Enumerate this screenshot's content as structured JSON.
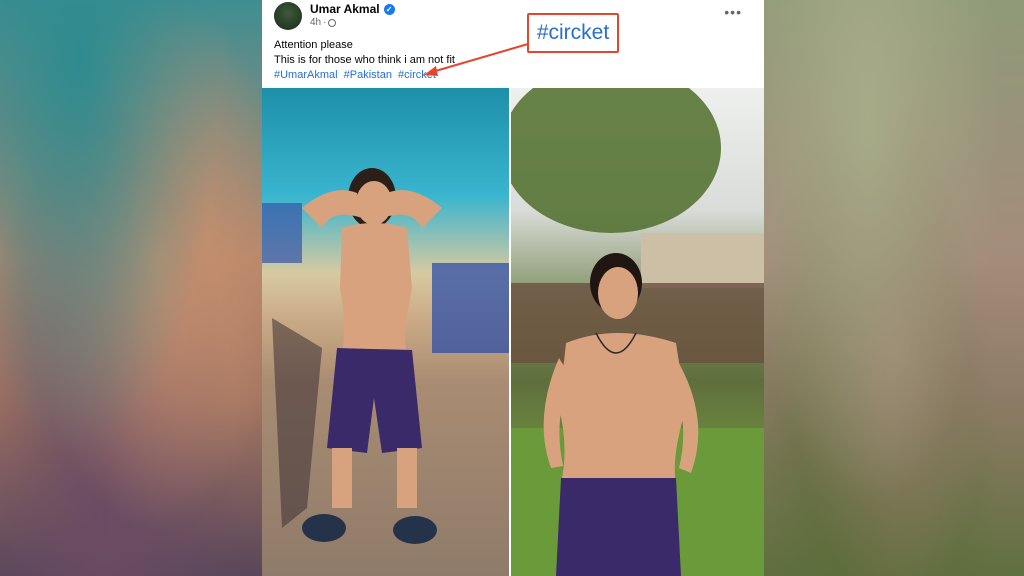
{
  "post": {
    "author": "Umar Akmal",
    "time": "4h",
    "more_icon": "more-horizontal-icon",
    "text_line1": "Attention please",
    "text_line2": "This is for those who think i am not fit",
    "hashtags": [
      "#UmarAkmal",
      "#Pakistan",
      "#circket"
    ]
  },
  "annotation": {
    "label": "#circket",
    "color": "#e2462f"
  },
  "colors": {
    "link": "#216fdb",
    "verified": "#1877f2"
  }
}
